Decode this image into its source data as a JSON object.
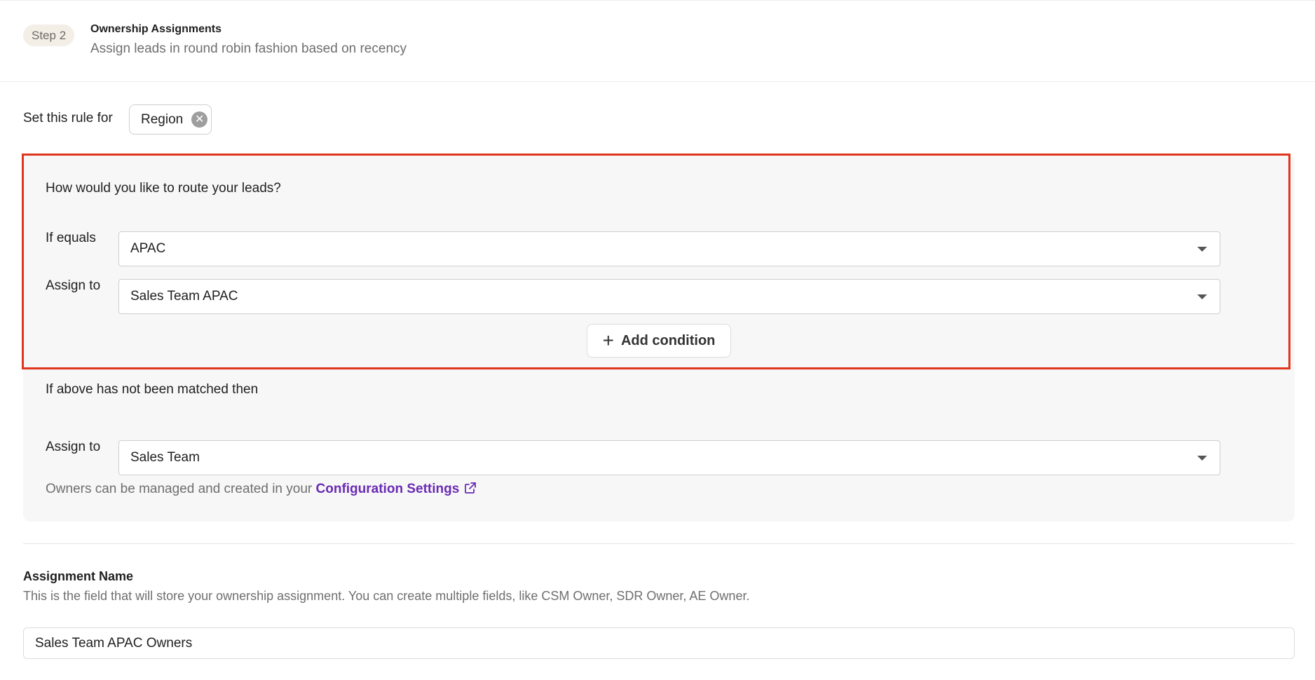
{
  "header": {
    "step_badge": "Step 2",
    "title": "Ownership Assignments",
    "subtitle": "Assign leads in round robin fashion based on recency"
  },
  "rule": {
    "label": "Set this rule for",
    "chip_label": "Region",
    "chip_remove_icon": "close-circle-icon"
  },
  "routing": {
    "question": "How would you like to route your leads?",
    "if_equals_label": "If equals",
    "if_equals_value": "APAC",
    "assign_to_label": "Assign to",
    "assign_to_value": "Sales Team APAC",
    "add_condition_label": "Add condition",
    "highlight_color": "#e0351f"
  },
  "fallback": {
    "text": "If above has not been matched then",
    "assign_to_label": "Assign to",
    "assign_to_value": "Sales Team",
    "note_prefix": "Owners can be managed and created in your",
    "link_label": "Configuration Settings",
    "link_color": "#6a2bb5"
  },
  "assignment": {
    "title": "Assignment Name",
    "description": "This is the field that will store your ownership assignment. You can create multiple fields, like CSM Owner, SDR Owner, AE Owner.",
    "value": "Sales Team APAC Owners"
  }
}
